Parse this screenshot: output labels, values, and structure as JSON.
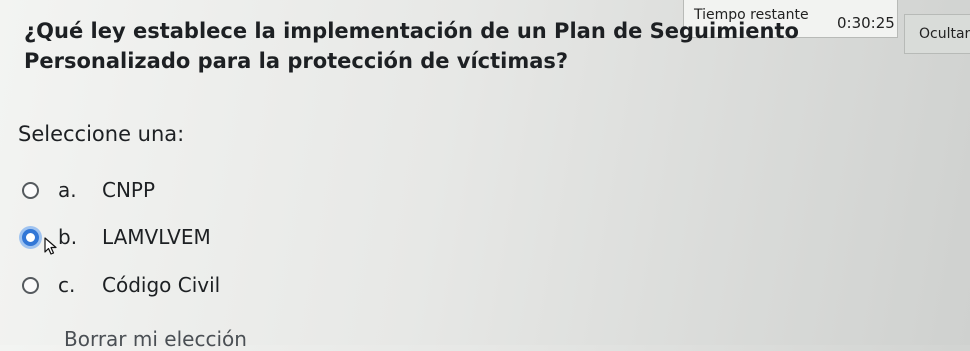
{
  "timer": {
    "label": "Tiempo restante",
    "value": "0:30:25",
    "hide_label": "Ocultar"
  },
  "question": {
    "text": "¿Qué ley establece la implementación de un Plan de Seguimiento Personalizado para la protección de víctimas?",
    "select_label": "Seleccione una:"
  },
  "options": [
    {
      "letter": "a.",
      "text": "CNPP",
      "selected": false
    },
    {
      "letter": "b.",
      "text": "LAMVLVEM",
      "selected": true
    },
    {
      "letter": "c.",
      "text": "Código Civil",
      "selected": false
    }
  ],
  "clear_choice": "Borrar mi elección",
  "colors": {
    "accent": "#3277d6",
    "text": "#1d2023"
  }
}
